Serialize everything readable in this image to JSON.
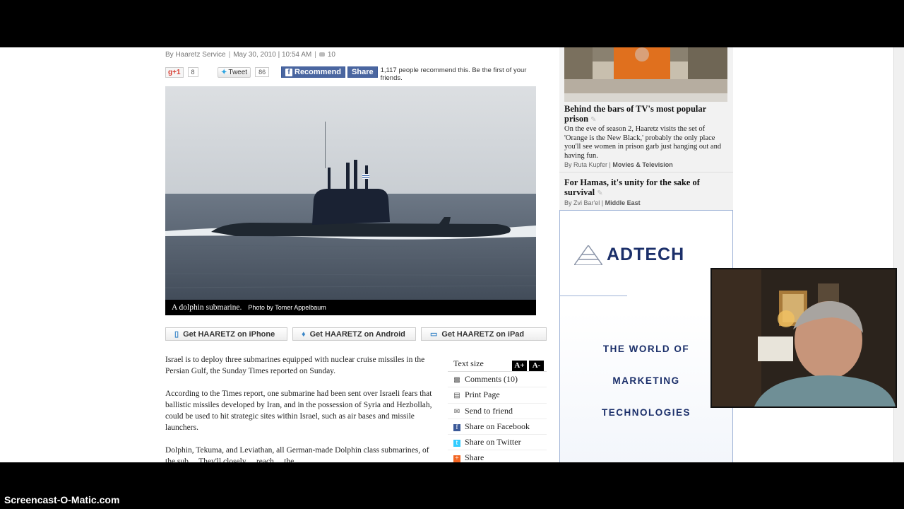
{
  "byline": {
    "author": "By Haaretz Service",
    "date": "May 30, 2010 | 10:54 AM",
    "comment_count": "10"
  },
  "social": {
    "gplus_label": "g+1",
    "gplus_count": "8",
    "tweet_label": "Tweet",
    "tweet_count": "86",
    "fb_recommend": "Recommend",
    "fb_share": "Share",
    "fb_text": "1,117 people recommend this. Be the first of your friends."
  },
  "photo": {
    "caption": "A dolphin submarine.",
    "credit": "Photo by Tomer Appelbaum"
  },
  "apps": {
    "iphone": "Get HAARETZ on iPhone",
    "android": "Get HAARETZ on Android",
    "ipad": "Get HAARETZ on iPad"
  },
  "article": {
    "p1": "Israel is to deploy three submarines equipped with nuclear cruise missiles in the Persian Gulf, the Sunday Times reported on Sunday.",
    "p2": "According to the Times report, one submarine had been sent over Israeli fears that ballistic missiles developed by Iran, and in the possession of Syria and Hezbollah, could be used to hit strategic sites within Israel, such as air bases and missile launchers.",
    "p3": "Dolphin, Tekuma, and Leviathan, all German-made Dolphin class submarines, of the sub ... They'll closely ... reach ... the ..."
  },
  "tools": {
    "text_size_label": "Text size",
    "increase": "A+",
    "decrease": "A-",
    "items": [
      {
        "label": "Comments (10)",
        "icon": "comment-icon"
      },
      {
        "label": "Print Page",
        "icon": "print-icon"
      },
      {
        "label": "Send to friend",
        "icon": "mail-icon"
      },
      {
        "label": "Share on Facebook",
        "icon": "facebook-icon"
      },
      {
        "label": "Share on Twitter",
        "icon": "twitter-icon"
      },
      {
        "label": "Share",
        "icon": "share-icon"
      }
    ]
  },
  "sidebar": {
    "story1": {
      "title": "Behind the bars of TV's most popular prison",
      "desc": "On the eve of season 2, Haaretz visits the set of 'Orange is the New Black,' probably the only place you'll see women in prison garb just hanging out and having fun.",
      "author": "By Ruta Kupfer",
      "section": "Movies & Television"
    },
    "story2": {
      "title": "For Hamas, it's unity for the sake of survival",
      "author": "By Zvi Bar'el",
      "section": "Middle East"
    }
  },
  "ad": {
    "brand": "ADTECH",
    "line1": "THE WORLD OF",
    "line2": "MARKETING",
    "line3": "TECHNOLOGIES"
  },
  "watermark": "Screencast-O-Matic.com",
  "colors": {
    "facebook": "#4a66a0",
    "ad_blue": "#1b2f6a",
    "gplus_red": "#d73d32"
  }
}
